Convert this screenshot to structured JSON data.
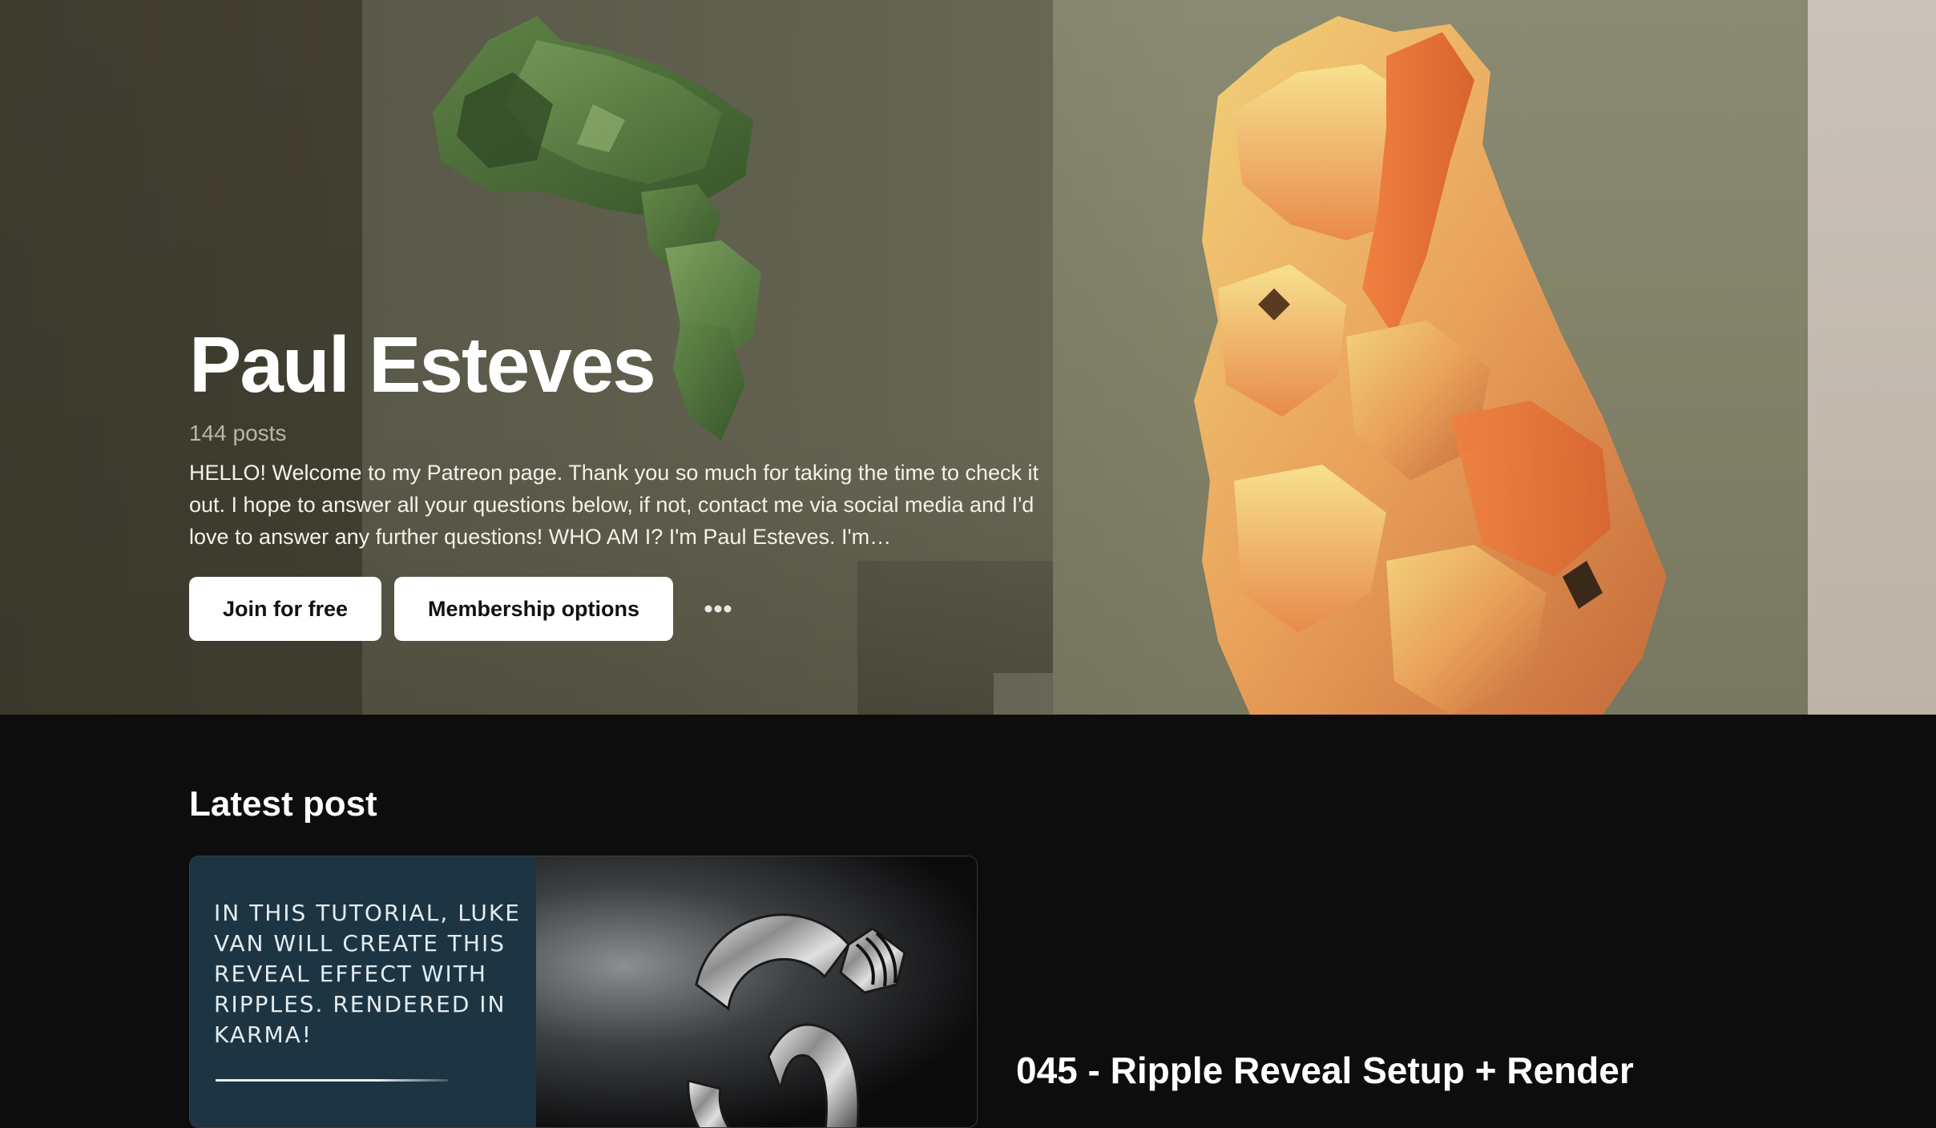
{
  "hero": {
    "creator_name": "Paul Esteves",
    "post_count": "144 posts",
    "bio": "HELLO! Welcome to my Patreon page. Thank you so much for taking the time to check it out. I hope to answer all your questions below, if not, contact me via social media and I'd love to answer any further questions! WHO AM I? I'm Paul Esteves. I'm…",
    "buttons": {
      "join_label": "Join for free",
      "membership_label": "Membership options",
      "more_icon": "more-horizontal-icon"
    }
  },
  "latest_post": {
    "section_title": "Latest post",
    "thumbnail_text": "IN THIS TUTORIAL, LUKE VAN WILL CREATE THIS REVEAL EFFECT WITH RIPPLES. RENDERED IN KARMA!",
    "title": "045 - Ripple Reveal Setup + Render"
  },
  "colors": {
    "page_background": "#0d0d0d",
    "button_background": "#ffffff",
    "thumbnail_panel": "#1d3543"
  }
}
